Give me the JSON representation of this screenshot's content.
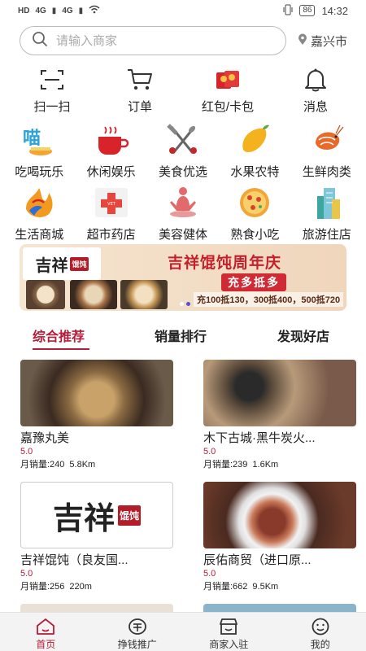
{
  "status_bar": {
    "left": [
      "HD",
      "4G",
      "4G"
    ],
    "battery": "86",
    "time": "14:32"
  },
  "search": {
    "placeholder": "请输入商家",
    "location": "嘉兴市"
  },
  "quick_actions": [
    {
      "label": "扫一扫",
      "icon": "scan-icon"
    },
    {
      "label": "订单",
      "icon": "cart-icon"
    },
    {
      "label": "红包/卡包",
      "icon": "red-envelope-icon"
    },
    {
      "label": "消息",
      "icon": "bell-icon"
    }
  ],
  "categories": [
    {
      "label": "吃喝玩乐",
      "icon": "eat-drink-icon"
    },
    {
      "label": "休闲娱乐",
      "icon": "coffee-cup-icon"
    },
    {
      "label": "美食优选",
      "icon": "fork-knife-icon"
    },
    {
      "label": "水果农特",
      "icon": "mango-icon"
    },
    {
      "label": "生鲜肉类",
      "icon": "shrimp-icon"
    },
    {
      "label": "生活商城",
      "icon": "flame-logo-icon"
    },
    {
      "label": "超市药店",
      "icon": "medical-cross-icon"
    },
    {
      "label": "美容健体",
      "icon": "yoga-icon"
    },
    {
      "label": "熟食小吃",
      "icon": "pizza-icon"
    },
    {
      "label": "旅游住店",
      "icon": "building-icon"
    }
  ],
  "banner": {
    "logo_text": "吉祥",
    "logo_badge": "馄饨",
    "title": "吉祥馄饨周年庆",
    "subtitle": "充多抵多",
    "offer": "充100抵130，300抵400，500抵720",
    "colors": {
      "accent": "#c31f2c",
      "background": "#f6e5d0"
    }
  },
  "tabs": [
    {
      "label": "综合推荐",
      "active": true
    },
    {
      "label": "销量排行",
      "active": false
    },
    {
      "label": "发现好店",
      "active": false
    }
  ],
  "shops": [
    {
      "name": "嘉豫丸美",
      "rating": "5.0",
      "sales": "月销量:240",
      "distance": "5.8Km"
    },
    {
      "name": "木下古城·黑牛炭火...",
      "rating": "5.0",
      "sales": "月销量:239",
      "distance": "1.6Km"
    },
    {
      "name": "吉祥馄饨（良友国...",
      "rating": "5.0",
      "sales": "月销量:256",
      "distance": "220m",
      "logo_text": "吉祥",
      "logo_badge": "馄饨"
    },
    {
      "name": "辰佑商贸（进口原...",
      "rating": "5.0",
      "sales": "月销量:662",
      "distance": "9.5Km"
    }
  ],
  "bottom_nav": [
    {
      "label": "首页",
      "icon": "home-icon",
      "active": true
    },
    {
      "label": "挣钱推广",
      "icon": "promote-icon",
      "active": false
    },
    {
      "label": "商家入驻",
      "icon": "store-icon",
      "active": false
    },
    {
      "label": "我的",
      "icon": "profile-icon",
      "active": false
    }
  ],
  "colors": {
    "brand": "#b31d3a",
    "text": "#222222"
  }
}
